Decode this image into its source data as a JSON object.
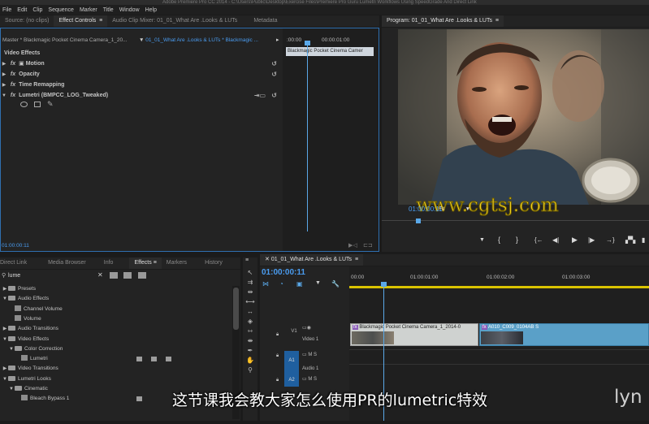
{
  "titlebar": "Adobe Premiere Pro CC 2014 - C:\\Users\\Public\\Desktop\\Exercise Files\\Premiere Pro Guru Lumetri Workflows Using SpeedGrade And Direct Link",
  "menu": [
    "File",
    "Edit",
    "Clip",
    "Sequence",
    "Marker",
    "Title",
    "Window",
    "Help"
  ],
  "top_tabs": [
    "Source: (no clips)",
    "Effect Controls",
    "Audio Clip Mixer: 01_01_What Are .Looks & LUTs",
    "Metadata"
  ],
  "effect_controls": {
    "master_label": "Master * Blackmagic Pocket Cinema Camera_1_20...",
    "sequence_label": "01_01_What Are .Looks & LUTs * Blackmagic ...",
    "ruler_start": ":00:00",
    "ruler_mark": "00:00:01:00",
    "clip_tooltip": "Blackmagic Pocket Cinema Camer",
    "section": "Video Effects",
    "effects": [
      "Motion",
      "Opacity",
      "Time Remapping",
      "Lumetri (BMPCC_LOG_Tweaked)"
    ],
    "timecode": "01:00:00:11"
  },
  "program": {
    "title": "Program: 01_01_What Are .Looks & LUTs",
    "timecode": "01:00:00:11",
    "fit": "Fit",
    "watermark": "www.cgtsj.com"
  },
  "bottom_tabs": [
    "Direct Link",
    "Media Browser",
    "Info",
    "Effects",
    "Markers",
    "History"
  ],
  "effects_panel": {
    "search": "lume",
    "tree": [
      {
        "label": "Presets",
        "depth": 0,
        "type": "folder"
      },
      {
        "label": "Audio Effects",
        "depth": 0,
        "type": "folder"
      },
      {
        "label": "Channel Volume",
        "depth": 1,
        "type": "fx"
      },
      {
        "label": "Volume",
        "depth": 1,
        "type": "fx"
      },
      {
        "label": "Audio Transitions",
        "depth": 0,
        "type": "folder"
      },
      {
        "label": "Video Effects",
        "depth": 0,
        "type": "folder"
      },
      {
        "label": "Color Correction",
        "depth": 1,
        "type": "folder"
      },
      {
        "label": "Lumetri",
        "depth": 2,
        "type": "fx"
      },
      {
        "label": "Video Transitions",
        "depth": 0,
        "type": "folder"
      },
      {
        "label": "Lumetri Looks",
        "depth": 0,
        "type": "folder"
      },
      {
        "label": "Cinematic",
        "depth": 1,
        "type": "folder"
      },
      {
        "label": "Bleach Bypass 1",
        "depth": 2,
        "type": "fx"
      }
    ]
  },
  "timeline": {
    "tab": "01_01_What Are .Looks & LUTs",
    "timecode": "01:00:00:11",
    "ruler": [
      "00:00",
      "01:00:01:00",
      "01:00:02:00",
      "01:00:03:00"
    ],
    "tracks": {
      "v1": "V1",
      "v1_name": "Video 1",
      "a1": "A1",
      "a1_name": "Audio 1",
      "a2": "A2"
    },
    "clip1": "Blackmagic Pocket Cinema Camera_1_2014-0",
    "clip2": "A010_C009_0104AB S"
  },
  "subtitle": "这节课我会教大家怎么使用PR的lumetric特效",
  "logo_text": "lyn",
  "colors": {
    "accent": "#4a9cf0",
    "clip_video": "#5aa0c8",
    "track_audio": "#1f5f9f",
    "playhead": "#5aa8e8"
  }
}
